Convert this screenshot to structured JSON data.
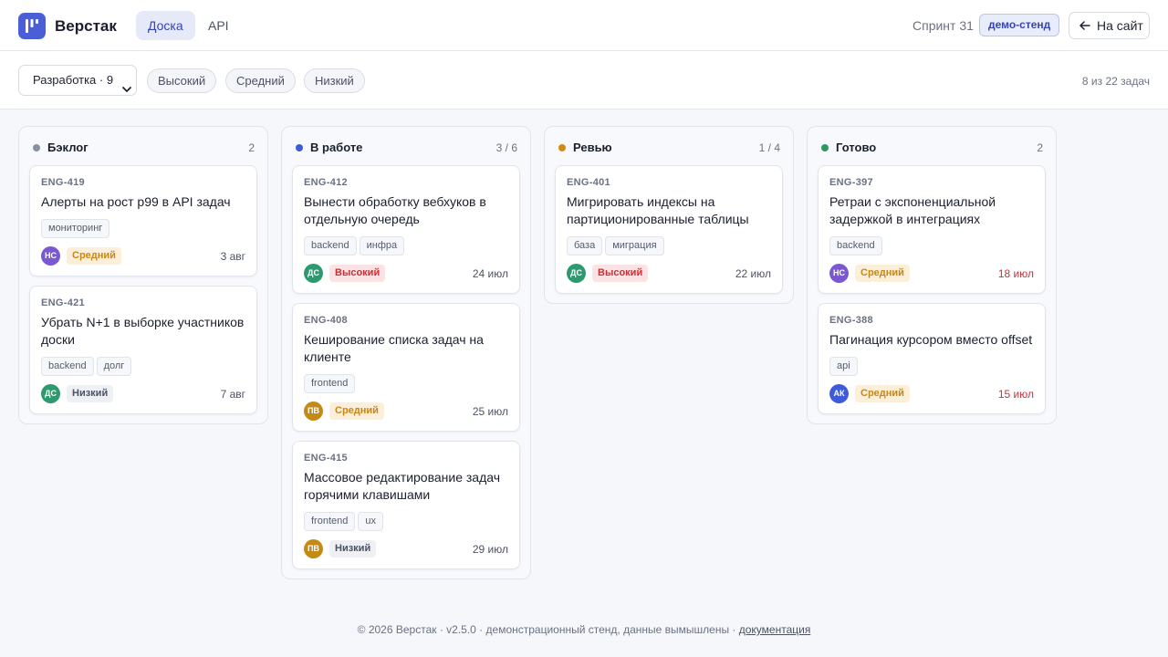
{
  "colors": {
    "accent": "#4a5fd6",
    "backlog": "#8a90a2",
    "in_progress": "#3e5bd8",
    "review": "#d08b14",
    "done": "#2c9a5e",
    "overdue": "#c8303a"
  },
  "header": {
    "logo_icon": "board-logo-icon",
    "brand": "Верстак",
    "tabs": [
      {
        "label": "Доска",
        "active": true
      },
      {
        "label": "API",
        "active": false
      }
    ],
    "sprint": "Спринт 31",
    "env_badge": "демо-стенд",
    "back_icon": "arrow-left-icon",
    "back_label": "На сайт"
  },
  "filters": {
    "team_select": "Разработка · 9",
    "chips": [
      "Высокий",
      "Средний",
      "Низкий"
    ],
    "count": "8 из 22 задач"
  },
  "board": {
    "columns": [
      {
        "title": "Бэклог",
        "count": "2",
        "color": "#8a90a2",
        "cards": [
          {
            "id": "ENG-419",
            "title": "Алерты на рост p99 в API задач",
            "tags": [
              "мониторинг"
            ],
            "avatar": "НС",
            "avatar_color": "#7b57d1",
            "priority": "Средний",
            "level": "mid",
            "due": "3 авг",
            "overdue": false
          },
          {
            "id": "ENG-421",
            "title": "Убрать N+1 в выборке участников доски",
            "tags": [
              "backend",
              "долг"
            ],
            "avatar": "ДС",
            "avatar_color": "#2c9a6e",
            "priority": "Низкий",
            "level": "low",
            "due": "7 авг",
            "overdue": false
          }
        ]
      },
      {
        "title": "В работе",
        "count": "3 / 6",
        "color": "#3e5bd8",
        "cards": [
          {
            "id": "ENG-412",
            "title": "Вынести обработку вебхуков в отдельную очередь",
            "tags": [
              "backend",
              "инфра"
            ],
            "avatar": "ДС",
            "avatar_color": "#2c9a6e",
            "priority": "Высокий",
            "level": "high",
            "due": "24 июл",
            "overdue": false
          },
          {
            "id": "ENG-408",
            "title": "Кеширование списка задач на клиенте",
            "tags": [
              "frontend"
            ],
            "avatar": "ПВ",
            "avatar_color": "#c48a16",
            "priority": "Средний",
            "level": "mid",
            "due": "25 июл",
            "overdue": false
          },
          {
            "id": "ENG-415",
            "title": "Массовое редактирование задач горячими клавишами",
            "tags": [
              "frontend",
              "ux"
            ],
            "avatar": "ПВ",
            "avatar_color": "#c48a16",
            "priority": "Низкий",
            "level": "low",
            "due": "29 июл",
            "overdue": false
          }
        ]
      },
      {
        "title": "Ревью",
        "count": "1 / 4",
        "color": "#d08b14",
        "cards": [
          {
            "id": "ENG-401",
            "title": "Мигрировать индексы на партиционированные таблицы",
            "tags": [
              "база",
              "миграция"
            ],
            "avatar": "ДС",
            "avatar_color": "#2c9a6e",
            "priority": "Высокий",
            "level": "high",
            "due": "22 июл",
            "overdue": false
          }
        ]
      },
      {
        "title": "Готово",
        "count": "2",
        "color": "#2c9a5e",
        "cards": [
          {
            "id": "ENG-397",
            "title": "Ретраи с экспоненциальной задержкой в интеграциях",
            "tags": [
              "backend"
            ],
            "avatar": "НС",
            "avatar_color": "#7b57d1",
            "priority": "Средний",
            "level": "mid",
            "due": "18 июл",
            "overdue": true
          },
          {
            "id": "ENG-388",
            "title": "Пагинация курсором вместо offset",
            "tags": [
              "api"
            ],
            "avatar": "АК",
            "avatar_color": "#3e5bd8",
            "priority": "Средний",
            "level": "mid",
            "due": "15 июл",
            "overdue": true
          }
        ]
      }
    ]
  },
  "footer": {
    "text": "© 2026 Верстак · v2.5.0 · демонстрационный стенд, данные вымышлены · ",
    "link": "документация"
  }
}
